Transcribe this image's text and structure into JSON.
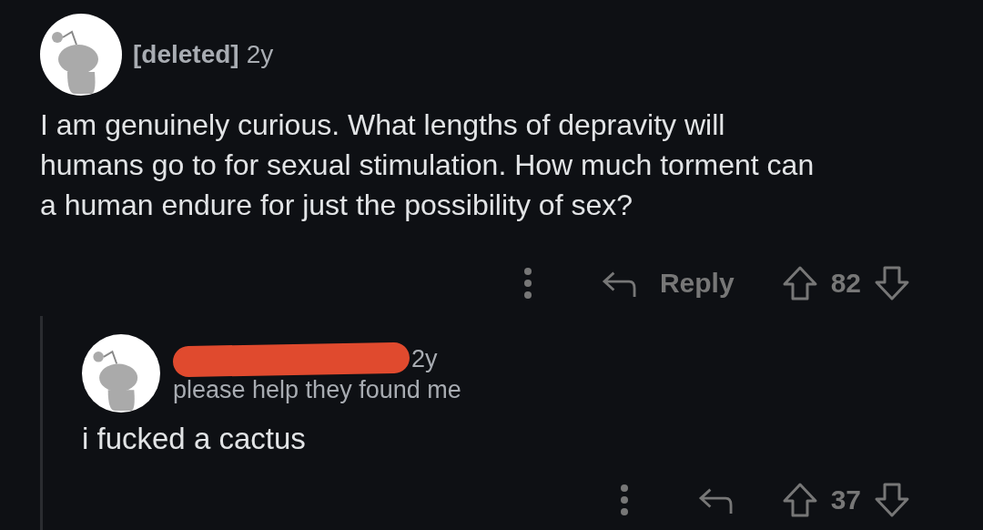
{
  "comment": {
    "author": "[deleted]",
    "age": "2y",
    "body": "I am genuinely curious. What lengths of depravity will humans go to for sexual stimulation. How much torment can a human endure for just the possibility of sex?",
    "actions": {
      "reply": "Reply",
      "score": "82"
    },
    "replies": [
      {
        "age": "2y",
        "flair": "please help they found me",
        "body": "i fucked a cactus",
        "actions": {
          "score": "37"
        }
      }
    ]
  }
}
